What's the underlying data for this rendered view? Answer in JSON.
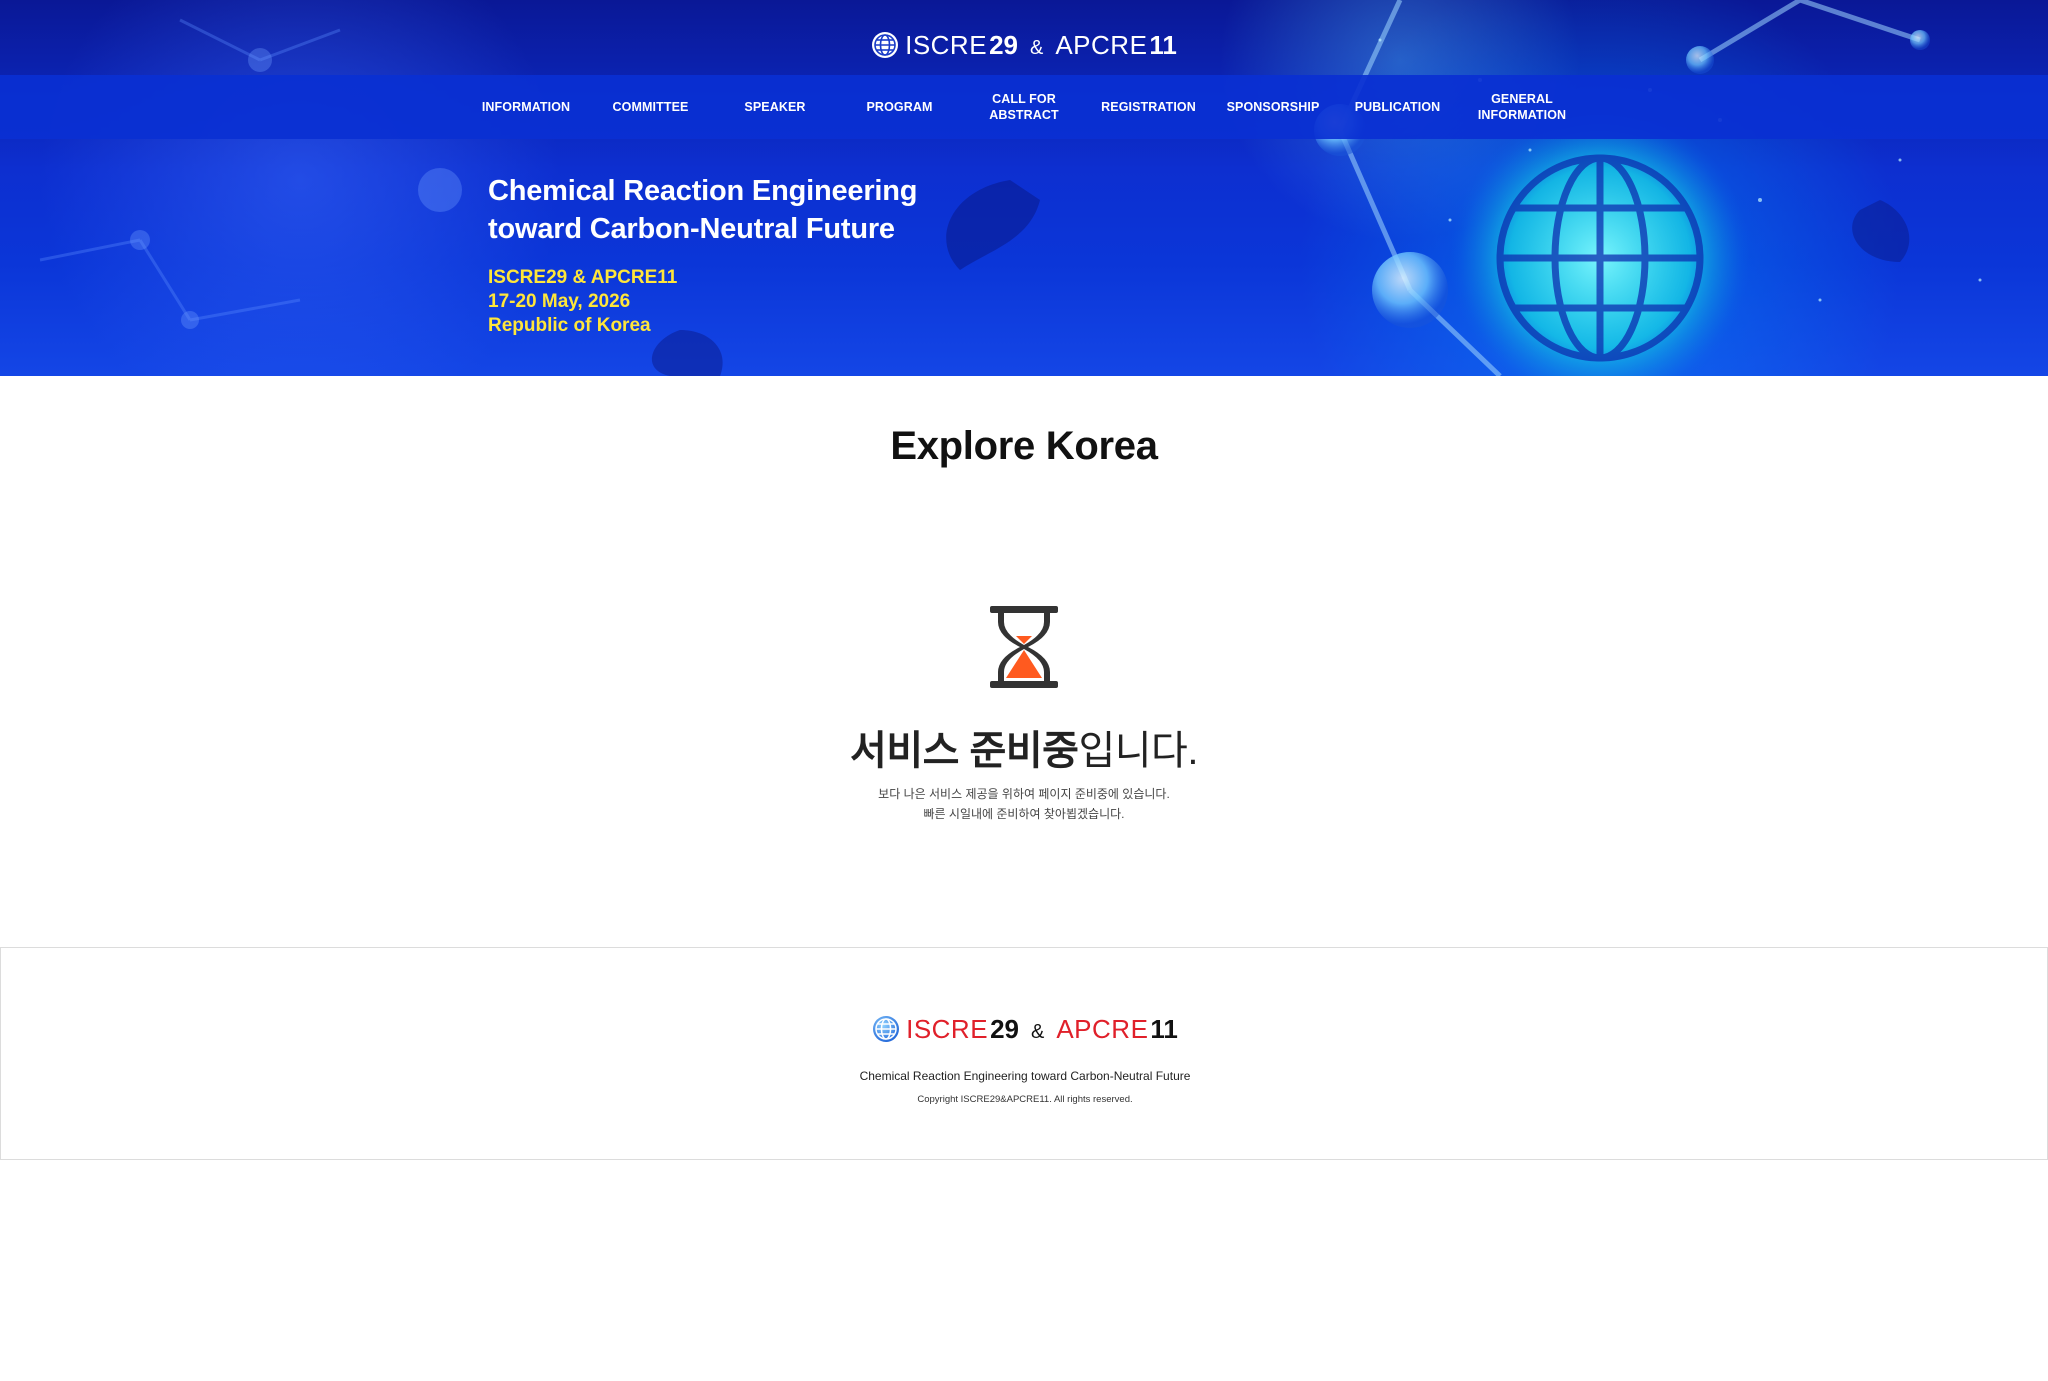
{
  "brand": {
    "iscre_name": "ISCRE",
    "iscre_num": "29",
    "amp": "&",
    "apcre_name": "APCRE",
    "apcre_num": "11",
    "globe_icon": "globe-icon"
  },
  "nav": {
    "items": [
      {
        "label": "INFORMATION"
      },
      {
        "label": "COMMITTEE"
      },
      {
        "label": "SPEAKER"
      },
      {
        "label": "PROGRAM"
      },
      {
        "label": "CALL FOR ABSTRACT"
      },
      {
        "label": "REGISTRATION"
      },
      {
        "label": "SPONSORSHIP"
      },
      {
        "label": "PUBLICATION"
      },
      {
        "label_line1": "GENERAL",
        "label_line2": "INFORMATION"
      }
    ]
  },
  "hero": {
    "title_line1": "Chemical Reaction Engineering",
    "title_line2": "toward Carbon-Neutral Future",
    "event_name": "ISCRE29 & APCRE11",
    "dates": "17-20 May, 2026",
    "location": "Republic of Korea"
  },
  "main": {
    "page_title": "Explore Korea",
    "hourglass_icon": "hourglass-icon",
    "prep_title_bold": "서비스 준비중",
    "prep_title_rest": "입니다.",
    "prep_desc_line1": "보다 나은 서비스 제공을 위하여 페이지 준비중에 있습니다.",
    "prep_desc_line2": "빠른 시일내에 준비하여 찾아뵙겠습니다."
  },
  "footer": {
    "tagline": "Chemical Reaction Engineering toward Carbon-Neutral Future",
    "copyright": "Copyright ISCRE29&APCRE11. All rights reserved."
  },
  "colors": {
    "nav_bar": "#0a30d2",
    "hero_subtitle_yellow": "#ffe63a",
    "footer_brand_red": "#e0202a",
    "hourglass_orange": "#ff5a1f"
  }
}
